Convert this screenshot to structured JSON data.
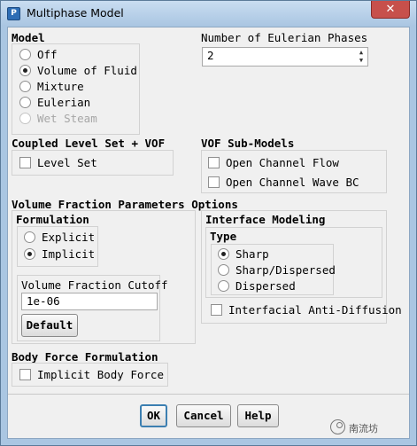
{
  "window": {
    "title": "Multiphase Model",
    "icon_letter": "P",
    "close_glyph": "✕"
  },
  "model": {
    "heading": "Model",
    "options": [
      {
        "label": "Off",
        "selected": false,
        "enabled": true
      },
      {
        "label": "Volume of Fluid",
        "selected": true,
        "enabled": true
      },
      {
        "label": "Mixture",
        "selected": false,
        "enabled": true
      },
      {
        "label": "Eulerian",
        "selected": false,
        "enabled": true
      },
      {
        "label": "Wet Steam",
        "selected": false,
        "enabled": false
      }
    ]
  },
  "eulerian_phases": {
    "label": "Number of Eulerian Phases",
    "value": "2"
  },
  "coupled_level_set": {
    "heading": "Coupled Level Set + VOF",
    "level_set_label": "Level Set",
    "level_set_checked": false
  },
  "vof_submodels": {
    "heading": "VOF Sub-Models",
    "open_channel_flow_label": "Open Channel Flow",
    "open_channel_wave_label": "Open Channel Wave BC"
  },
  "vfp_options": {
    "heading": "Volume Fraction Parameters Options",
    "formulation": {
      "heading": "Formulation",
      "explicit_label": "Explicit",
      "implicit_label": "Implicit",
      "selected": "Implicit"
    },
    "cutoff": {
      "label": "Volume Fraction Cutoff",
      "value": "1e-06",
      "default_button": "Default"
    }
  },
  "interface_modeling": {
    "heading": "Interface Modeling",
    "type_heading": "Type",
    "sharp_label": "Sharp",
    "sharp_dispersed_label": "Sharp/Dispersed",
    "dispersed_label": "Dispersed",
    "selected": "Sharp",
    "anti_diffusion_label": "Interfacial Anti-Diffusion"
  },
  "body_force": {
    "heading": "Body Force Formulation",
    "implicit_body_force_label": "Implicit Body Force"
  },
  "buttons": {
    "ok": "OK",
    "cancel": "Cancel",
    "help": "Help"
  },
  "watermark": {
    "text": "南流坊"
  }
}
